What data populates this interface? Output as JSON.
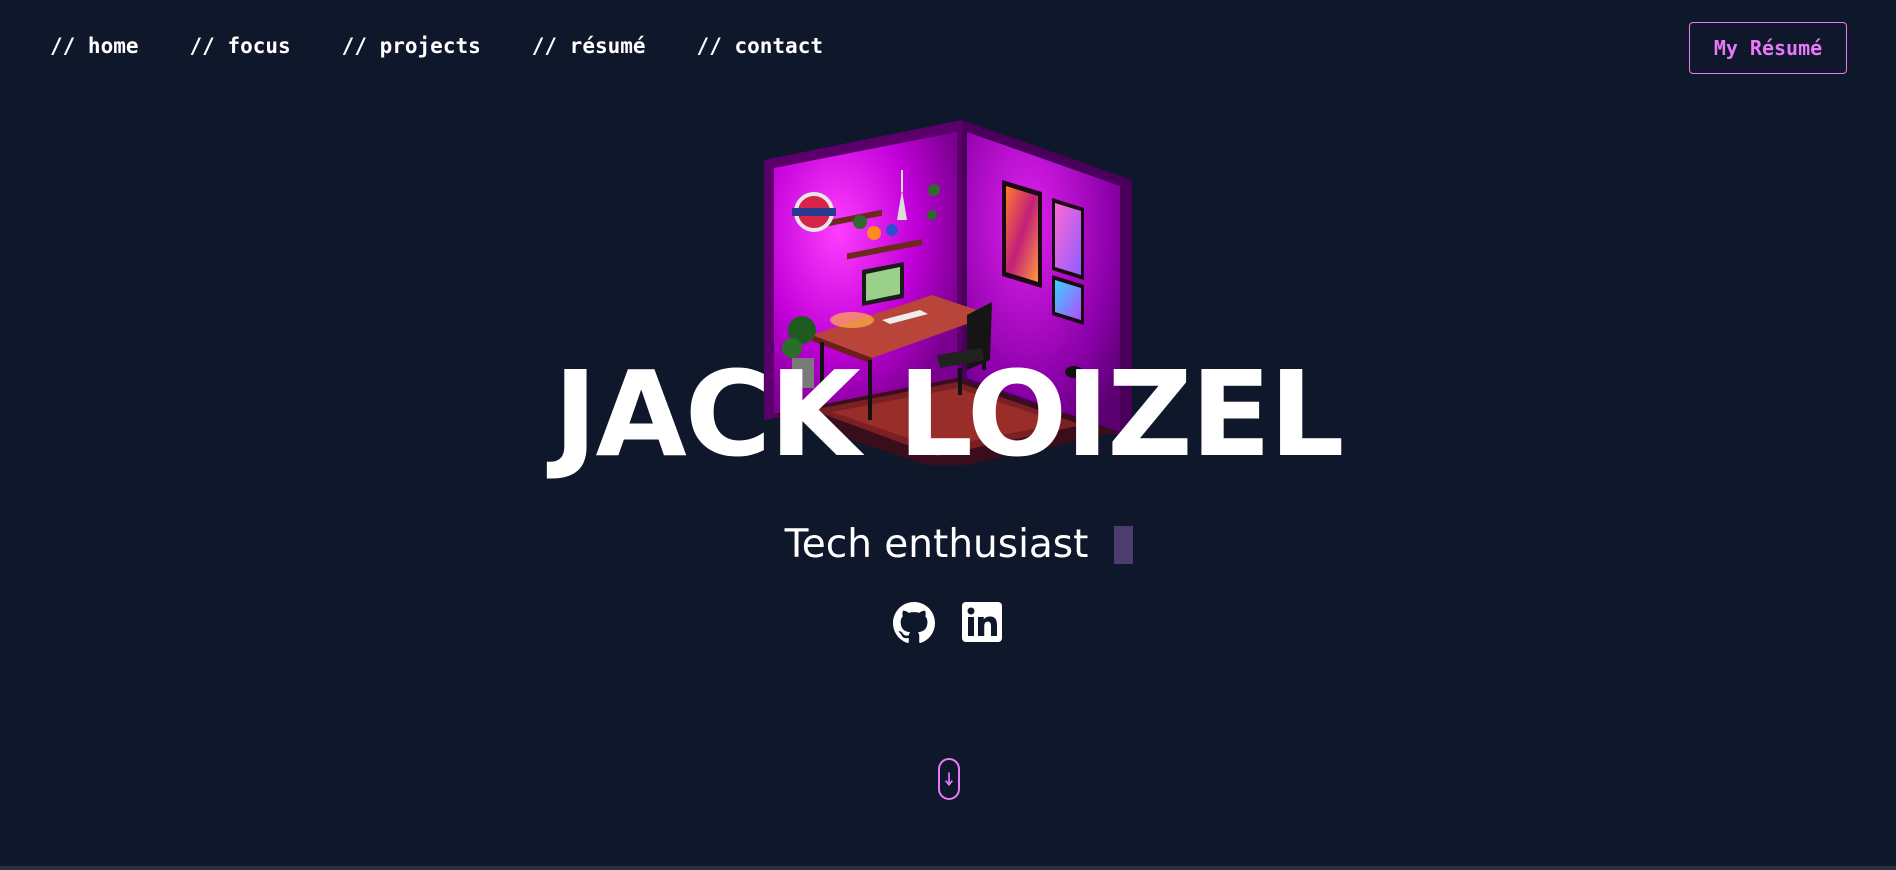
{
  "nav": {
    "items": [
      {
        "label": "// home"
      },
      {
        "label": "// focus"
      },
      {
        "label": "// projects"
      },
      {
        "label": "// résumé"
      },
      {
        "label": "// contact"
      }
    ],
    "resume_button": "My Résumé"
  },
  "hero": {
    "name": "JACK LOIZEL",
    "tagline": "Tech enthusiast"
  },
  "socials": [
    {
      "icon": "github-icon"
    },
    {
      "icon": "linkedin-icon"
    }
  ],
  "colors": {
    "background": "#0f172a",
    "accent": "#e879f9",
    "text": "#ffffff",
    "cursor": "#4c3d6e"
  }
}
